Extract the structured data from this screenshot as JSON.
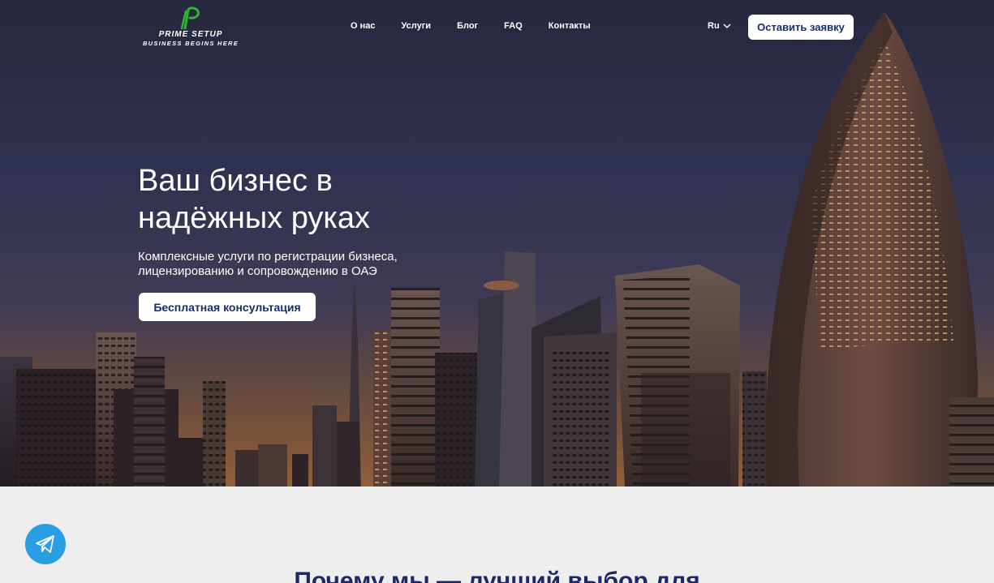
{
  "header": {
    "brand": "PRIME SETUP",
    "tagline": "BUSINESS BEGINS HERE",
    "nav": [
      {
        "label": "О нас"
      },
      {
        "label": "Услуги"
      },
      {
        "label": "Блог"
      },
      {
        "label": "FAQ"
      },
      {
        "label": "Контакты"
      }
    ],
    "language": "Ru",
    "cta_label": "Оставить заявку"
  },
  "hero": {
    "title": "Ваш бизнес в надёжных руках",
    "subtitle": "Комплексные услуги по регистрации бизнеса, лицензированию и сопровождению в ОАЭ",
    "button_label": "Бесплатная консультация"
  },
  "sections": {
    "why_title": "Почему мы — лучший выбор для"
  },
  "icons": {
    "logo": "prime-setup-p-logo",
    "language_chevron": "chevron-down-icon",
    "telegram": "telegram-icon"
  },
  "colors": {
    "accent_green": "#2fb52f",
    "button_text": "#14306b",
    "telegram_blue": "#2a9ee3",
    "section_bg": "#eeeeef",
    "section_title": "#1b2a66"
  }
}
